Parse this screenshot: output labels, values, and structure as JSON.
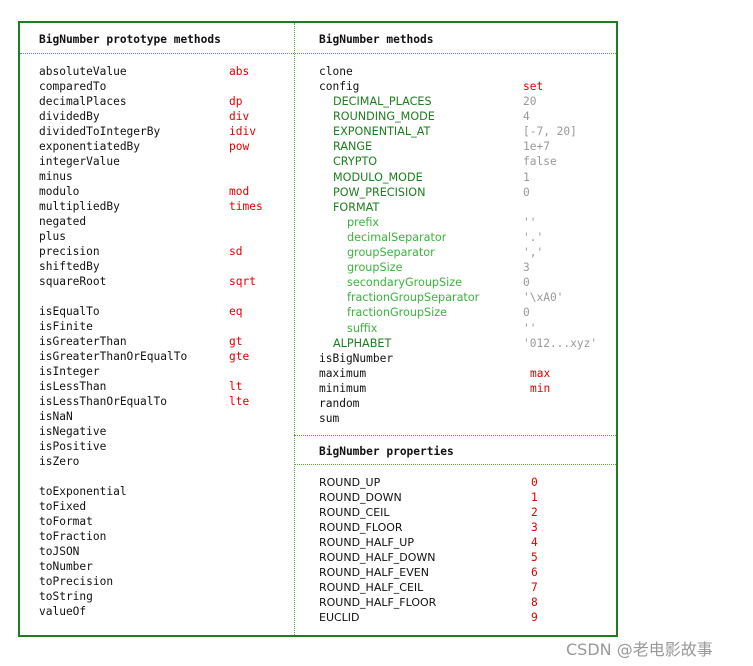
{
  "left": {
    "title": "BigNumber prototype methods",
    "groups": [
      [
        [
          "absoluteValue",
          "abs"
        ],
        [
          "comparedTo",
          ""
        ],
        [
          "decimalPlaces",
          "dp"
        ],
        [
          "dividedBy",
          "div"
        ],
        [
          "dividedToIntegerBy",
          "idiv"
        ],
        [
          "exponentiatedBy",
          "pow"
        ],
        [
          "integerValue",
          ""
        ],
        [
          "minus",
          ""
        ],
        [
          "modulo",
          "mod"
        ],
        [
          "multipliedBy",
          "times"
        ],
        [
          "negated",
          ""
        ],
        [
          "plus",
          ""
        ],
        [
          "precision",
          "sd"
        ],
        [
          "shiftedBy",
          ""
        ],
        [
          "squareRoot",
          "sqrt"
        ]
      ],
      [
        [
          "isEqualTo",
          "eq"
        ],
        [
          "isFinite",
          ""
        ],
        [
          "isGreaterThan",
          "gt"
        ],
        [
          "isGreaterThanOrEqualTo",
          "gte"
        ],
        [
          "isInteger",
          ""
        ],
        [
          "isLessThan",
          "lt"
        ],
        [
          "isLessThanOrEqualTo",
          "lte"
        ],
        [
          "isNaN",
          ""
        ],
        [
          "isNegative",
          ""
        ],
        [
          "isPositive",
          ""
        ],
        [
          "isZero",
          ""
        ]
      ],
      [
        [
          "toExponential",
          ""
        ],
        [
          "toFixed",
          ""
        ],
        [
          "toFormat",
          ""
        ],
        [
          "toFraction",
          ""
        ],
        [
          "toJSON",
          ""
        ],
        [
          "toNumber",
          ""
        ],
        [
          "toPrecision",
          ""
        ],
        [
          "toString",
          ""
        ],
        [
          "valueOf",
          ""
        ]
      ]
    ]
  },
  "methods": {
    "title": "BigNumber methods",
    "rows": [
      {
        "name": "clone",
        "alias": "",
        "level": 0
      },
      {
        "name": "config",
        "alias": "set",
        "level": 0
      },
      {
        "name": "DECIMAL_PLACES",
        "value": "20",
        "level": 1
      },
      {
        "name": "ROUNDING_MODE",
        "value": "4",
        "level": 1
      },
      {
        "name": "EXPONENTIAL_AT",
        "value": "[-7, 20]",
        "level": 1
      },
      {
        "name": "RANGE",
        "value": "1e+7",
        "level": 1
      },
      {
        "name": "CRYPTO",
        "value": "false",
        "level": 1
      },
      {
        "name": "MODULO_MODE",
        "value": "1",
        "level": 1
      },
      {
        "name": "POW_PRECISION",
        "value": "0",
        "level": 1
      },
      {
        "name": "FORMAT",
        "value": "",
        "level": 1
      },
      {
        "name": "prefix",
        "value": "''",
        "level": 2
      },
      {
        "name": "decimalSeparator",
        "value": "'.'",
        "level": 2
      },
      {
        "name": "groupSeparator",
        "value": "','",
        "level": 2
      },
      {
        "name": "groupSize",
        "value": "3",
        "level": 2
      },
      {
        "name": "secondaryGroupSize",
        "value": "0",
        "level": 2
      },
      {
        "name": "fractionGroupSeparator",
        "value": "'\\xA0'",
        "level": 2
      },
      {
        "name": "fractionGroupSize",
        "value": "0",
        "level": 2
      },
      {
        "name": "suffix",
        "value": "''",
        "level": 2
      },
      {
        "name": "ALPHABET",
        "value": "'012...xyz'",
        "level": 1
      },
      {
        "name": "isBigNumber",
        "alias": "",
        "level": 0
      },
      {
        "name": "maximum",
        "alias": "max",
        "level": 0
      },
      {
        "name": "minimum",
        "alias": "min",
        "level": 0
      },
      {
        "name": "random",
        "alias": "",
        "level": 0
      },
      {
        "name": "sum",
        "alias": "",
        "level": 0
      }
    ]
  },
  "properties": {
    "title": "BigNumber properties",
    "rows": [
      [
        "ROUND_UP",
        "0"
      ],
      [
        "ROUND_DOWN",
        "1"
      ],
      [
        "ROUND_CEIL",
        "2"
      ],
      [
        "ROUND_FLOOR",
        "3"
      ],
      [
        "ROUND_HALF_UP",
        "4"
      ],
      [
        "ROUND_HALF_DOWN",
        "5"
      ],
      [
        "ROUND_HALF_EVEN",
        "6"
      ],
      [
        "ROUND_HALF_CEIL",
        "7"
      ],
      [
        "ROUND_HALF_FLOOR",
        "8"
      ],
      [
        "EUCLID",
        "9"
      ]
    ]
  },
  "watermark": "CSDN @老电影故事"
}
